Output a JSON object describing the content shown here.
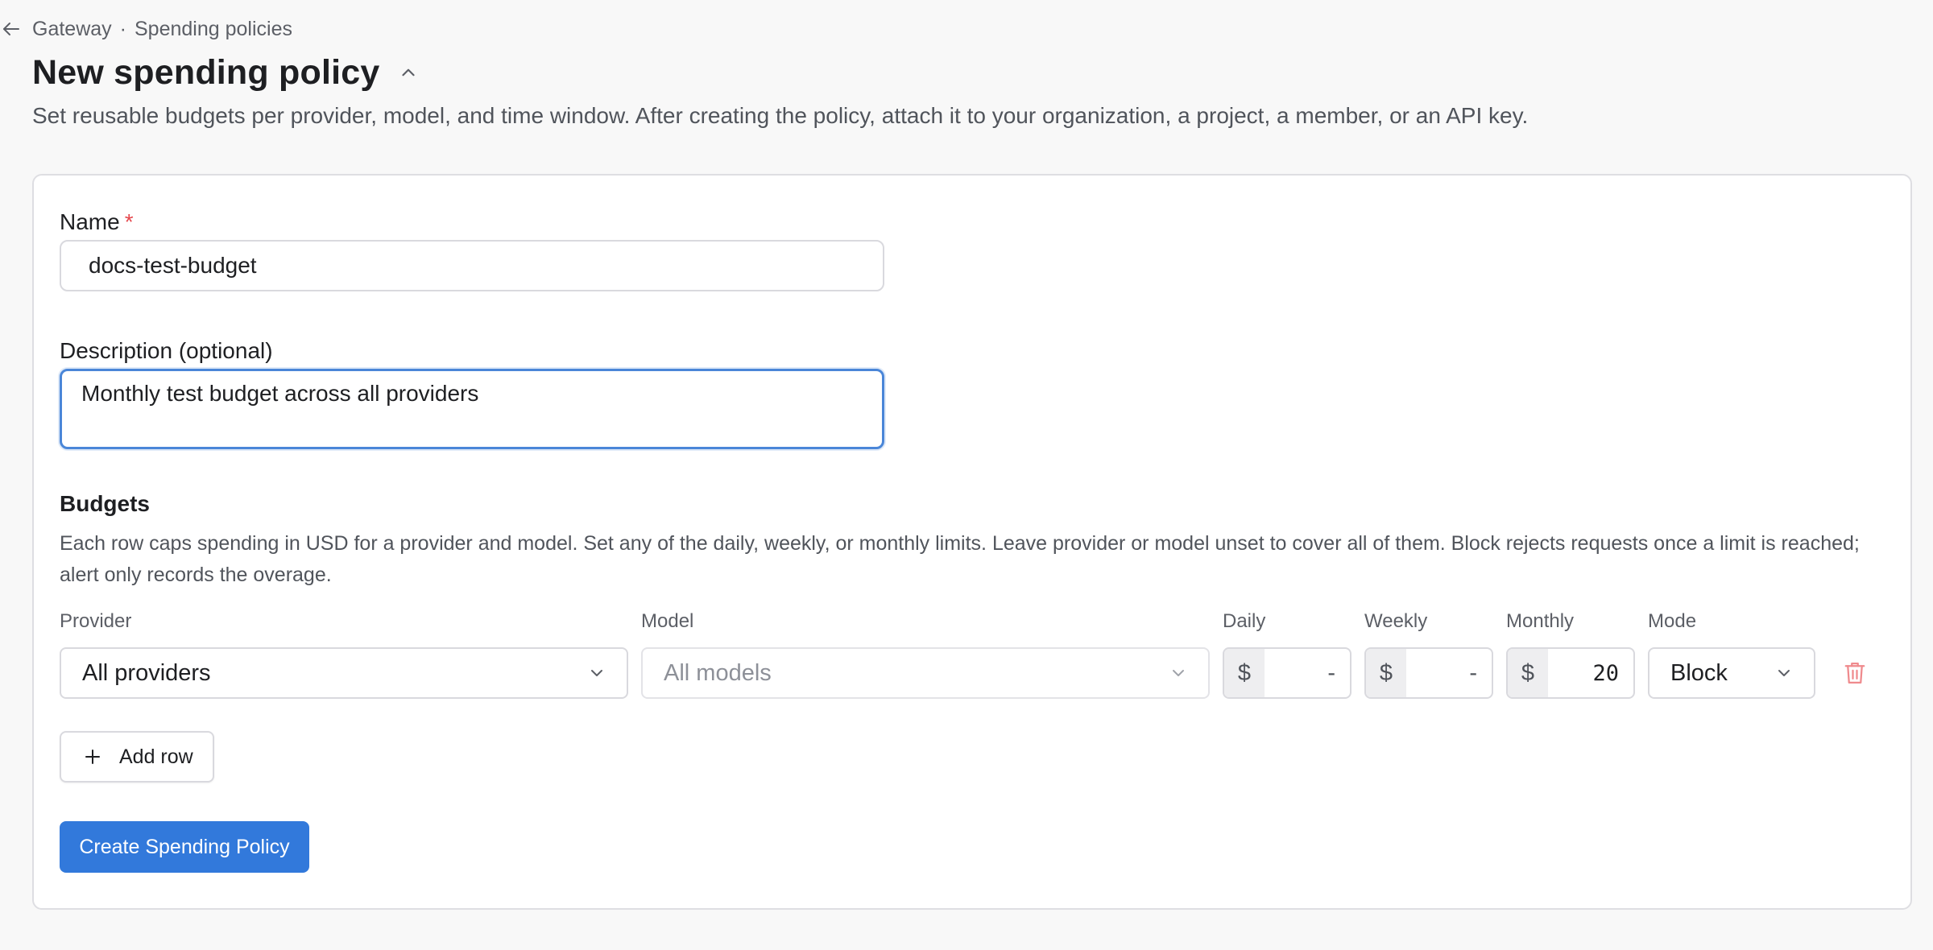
{
  "breadcrumb": {
    "parent": "Gateway",
    "separator": "·",
    "current": "Spending policies",
    "back_icon": "arrow-left-icon"
  },
  "header": {
    "title": "New spending policy",
    "collapse_icon": "chevron-up-icon",
    "subtitle": "Set reusable budgets per provider, model, and time window. After creating the policy, attach it to your organization, a project, a member, or an API key."
  },
  "form": {
    "name": {
      "label": "Name",
      "required_mark": "*",
      "value": "docs-test-budget"
    },
    "description": {
      "label": "Description (optional)",
      "value": "Monthly test budget across all providers"
    },
    "budgets": {
      "title": "Budgets",
      "description": "Each row caps spending in USD for a provider and model. Set any of the daily, weekly, or monthly limits. Leave provider or model unset to cover all of them. Block rejects requests once a limit is reached; alert only records the overage.",
      "columns": {
        "provider": "Provider",
        "model": "Model",
        "daily": "Daily",
        "weekly": "Weekly",
        "monthly": "Monthly",
        "mode": "Mode"
      },
      "rows": [
        {
          "provider": "All providers",
          "model_placeholder": "All models",
          "currency_symbol": "$",
          "daily": "-",
          "weekly": "-",
          "monthly": "20",
          "mode": "Block",
          "delete_icon": "trash-icon"
        }
      ],
      "add_row_label": "Add row"
    },
    "submit_label": "Create Spending Policy"
  },
  "colors": {
    "accent": "#3279db",
    "focus_border": "#4a86d8",
    "danger": "#e5484d",
    "page_bg": "#f8f8f8"
  }
}
